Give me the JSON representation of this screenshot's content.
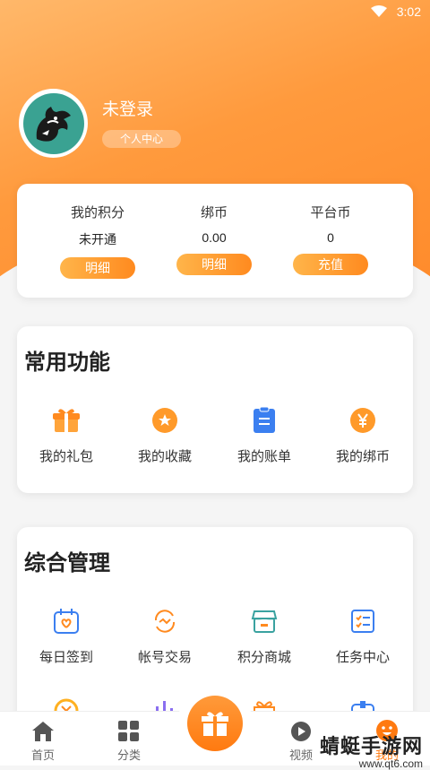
{
  "status_bar": {
    "time": "3:02"
  },
  "profile": {
    "username": "未登录",
    "center_label": "个人中心"
  },
  "points": [
    {
      "label": "我的积分",
      "value": "未开通",
      "button": "明细"
    },
    {
      "label": "绑币",
      "value": "0.00",
      "button": "明细"
    },
    {
      "label": "平台币",
      "value": "0",
      "button": "充值"
    }
  ],
  "common": {
    "title": "常用功能",
    "items": [
      {
        "label": "我的礼包",
        "icon": "gift-icon"
      },
      {
        "label": "我的收藏",
        "icon": "star-icon"
      },
      {
        "label": "我的账单",
        "icon": "bill-icon"
      },
      {
        "label": "我的绑币",
        "icon": "yen-icon"
      }
    ]
  },
  "manage": {
    "title": "综合管理",
    "items": [
      {
        "label": "每日签到",
        "icon": "calendar-icon"
      },
      {
        "label": "帐号交易",
        "icon": "trade-icon"
      },
      {
        "label": "积分商城",
        "icon": "shop-icon"
      },
      {
        "label": "任务中心",
        "icon": "task-icon"
      }
    ]
  },
  "tabbar": [
    {
      "label": "首页",
      "icon": "home-icon"
    },
    {
      "label": "分类",
      "icon": "category-icon"
    },
    {
      "label": "",
      "icon": "gift-icon"
    },
    {
      "label": "视频",
      "icon": "video-icon"
    },
    {
      "label": "我的",
      "icon": "profile-icon"
    }
  ],
  "watermark": {
    "title": "蜻蜓手游网",
    "url": "www.qt6.com"
  },
  "colors": {
    "accent": "#ff8a1f",
    "hero": "#ff9a3d",
    "blue": "#3b7ff0"
  }
}
